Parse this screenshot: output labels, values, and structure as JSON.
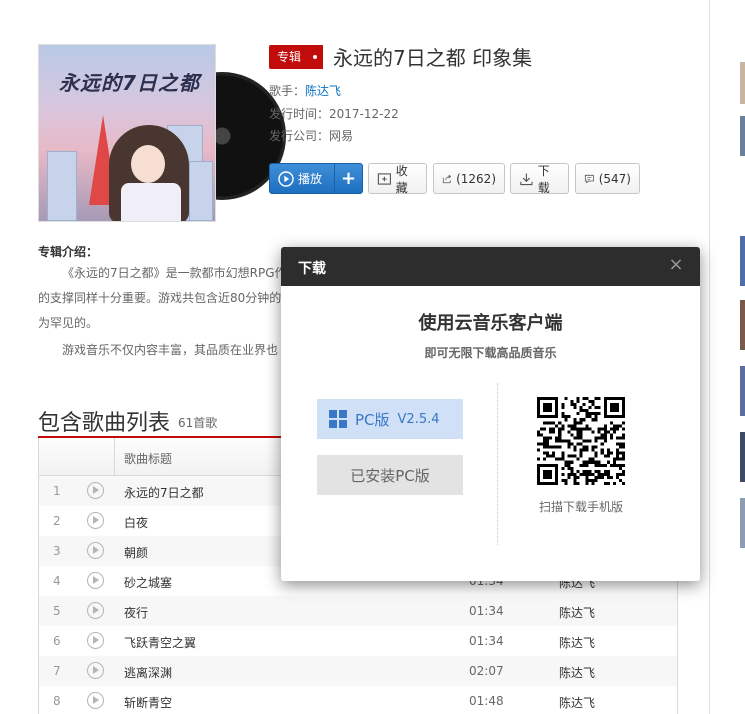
{
  "album": {
    "tag": "专辑",
    "title": "永远的7日之都 印象集",
    "cover_text": "永远的7日之都",
    "artist_label": "歌手：",
    "artist": "陈达飞",
    "release_label": "发行时间：",
    "release_date": "2017-12-22",
    "company_label": "发行公司：",
    "company": "网易"
  },
  "actions": {
    "play": "播放",
    "add": "+",
    "favorite": "收藏",
    "share": "(1262)",
    "download": "下载",
    "comment": "(547)"
  },
  "intro": {
    "heading": "专辑介绍：",
    "line1": "《永远的7日之都》是一款都市幻想RPG作",
    "line2": "的支撑同样十分重要。游戏共包含近80分钟的",
    "line3": "为罕见的。",
    "line4": "游戏音乐不仅内容丰富，其品质在业界也"
  },
  "songs": {
    "title": "包含歌曲列表",
    "count": "61首歌",
    "header_title": "歌曲标题",
    "rows": [
      {
        "num": "1",
        "name": "永远的7日之都",
        "duration": "",
        "artist": ""
      },
      {
        "num": "2",
        "name": "白夜",
        "duration": "",
        "artist": ""
      },
      {
        "num": "3",
        "name": "朝颜",
        "duration": "",
        "artist": ""
      },
      {
        "num": "4",
        "name": "砂之城塞",
        "duration": "01:34",
        "artist": "陈达飞"
      },
      {
        "num": "5",
        "name": "夜行",
        "duration": "01:34",
        "artist": "陈达飞"
      },
      {
        "num": "6",
        "name": "飞跃青空之翼",
        "duration": "01:34",
        "artist": "陈达飞"
      },
      {
        "num": "7",
        "name": "逃离深渊",
        "duration": "02:07",
        "artist": "陈达飞"
      },
      {
        "num": "8",
        "name": "斩断青空",
        "duration": "01:48",
        "artist": "陈达飞"
      }
    ]
  },
  "modal": {
    "title": "下载",
    "close": "×",
    "heading": "使用云音乐客户端",
    "subheading": "即可无限下载高品质音乐",
    "pc_label": "PC版",
    "pc_version": "V2.5.4",
    "installed_label": "已安装PC版",
    "qr_caption": "扫描下载手机版"
  },
  "colors": {
    "brand_red": "#c20c0c",
    "play_blue": "#1d6fc0",
    "link_blue": "#0c73c2",
    "modal_header": "#2d2d2d"
  },
  "icons": {
    "play": "play-circle-icon",
    "favorite": "folder-plus-icon",
    "share": "share-icon",
    "download": "download-icon",
    "comment": "comment-icon",
    "windows": "windows-logo-icon",
    "close": "close-icon"
  }
}
